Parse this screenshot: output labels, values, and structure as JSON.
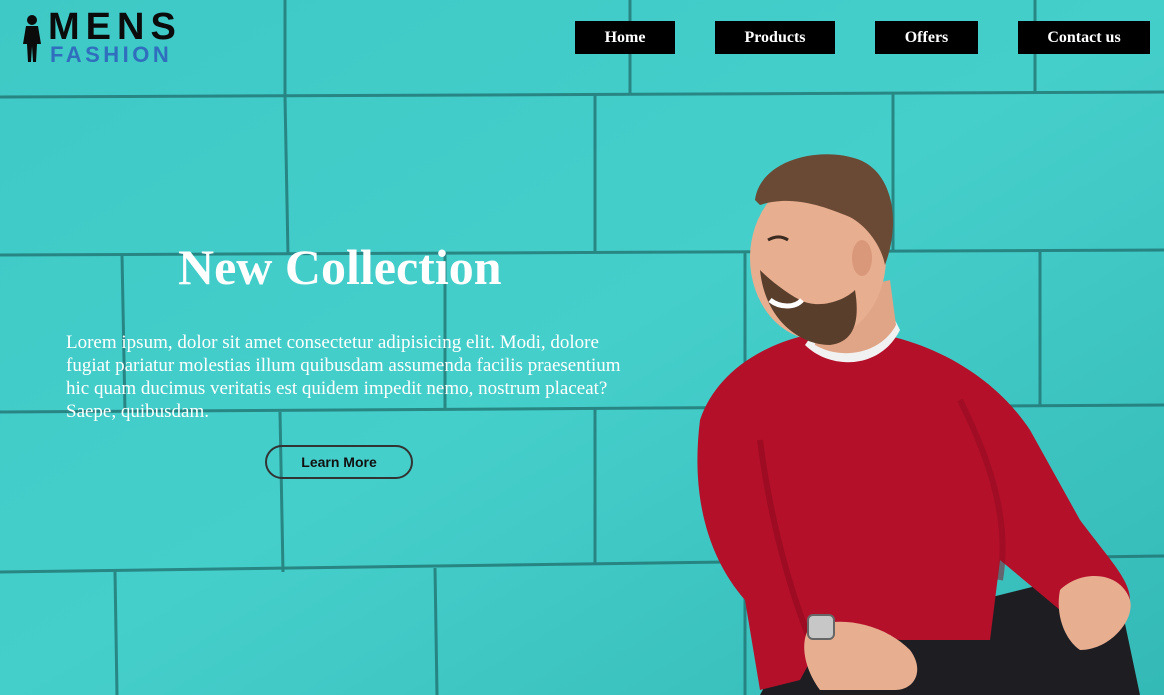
{
  "logo": {
    "line1": "MENS",
    "line2": "FASHION",
    "figure_icon": "man-silhouette-icon"
  },
  "nav": {
    "items": [
      "Home",
      "Products",
      "Offers",
      "Contact us"
    ]
  },
  "hero": {
    "title": "New Collection",
    "description": "Lorem ipsum, dolor sit amet consectetur adipisicing elit. Modi, dolore fugiat pariatur molestias illum quibusdam assumenda facilis praesentium hic quam ducimus veritatis est quidem impedit nemo, nostrum placeat? Saepe, quibusdam.",
    "button": "Learn More"
  },
  "colors": {
    "background_wall": "#3fc7c4",
    "nav_bg": "#000000",
    "nav_text": "#ffffff",
    "sweater": "#b5102a",
    "logo_accent": "#2f6fbd"
  }
}
